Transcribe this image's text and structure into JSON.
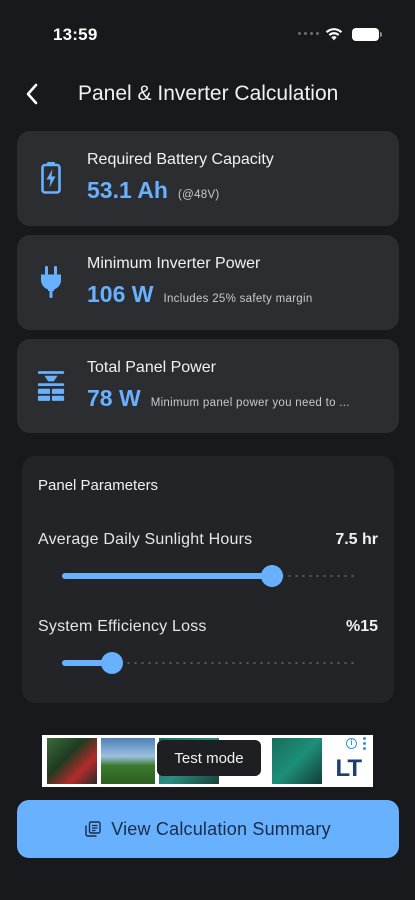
{
  "status_bar": {
    "time": "13:59"
  },
  "header": {
    "title": "Panel & Inverter Calculation"
  },
  "cards": [
    {
      "icon": "battery-charging-icon",
      "label": "Required Battery Capacity",
      "value": "53.1 Ah",
      "note": "(@48V)"
    },
    {
      "icon": "plug-icon",
      "label": "Minimum Inverter Power",
      "value": "106 W",
      "note": "Includes 25% safety margin"
    },
    {
      "icon": "solar-panel-icon",
      "label": "Total Panel Power",
      "value": "78 W",
      "note": "Minimum panel power you need to ..."
    }
  ],
  "params": {
    "title": "Panel Parameters",
    "sunlight": {
      "label": "Average Daily Sunlight Hours",
      "value": "7.5 hr",
      "fraction": 0.72
    },
    "efficiency": {
      "label": "System Efficiency Loss",
      "value": "%15",
      "fraction": 0.17
    }
  },
  "ad": {
    "logo": "LT",
    "info": "i",
    "toast": "Test mode"
  },
  "cta": {
    "label": "View Calculation Summary",
    "icon": "summary-document-icon"
  },
  "colors": {
    "accent": "#67b1ff",
    "background": "#18191c",
    "card": "#2c2d31",
    "panel": "#232427"
  }
}
